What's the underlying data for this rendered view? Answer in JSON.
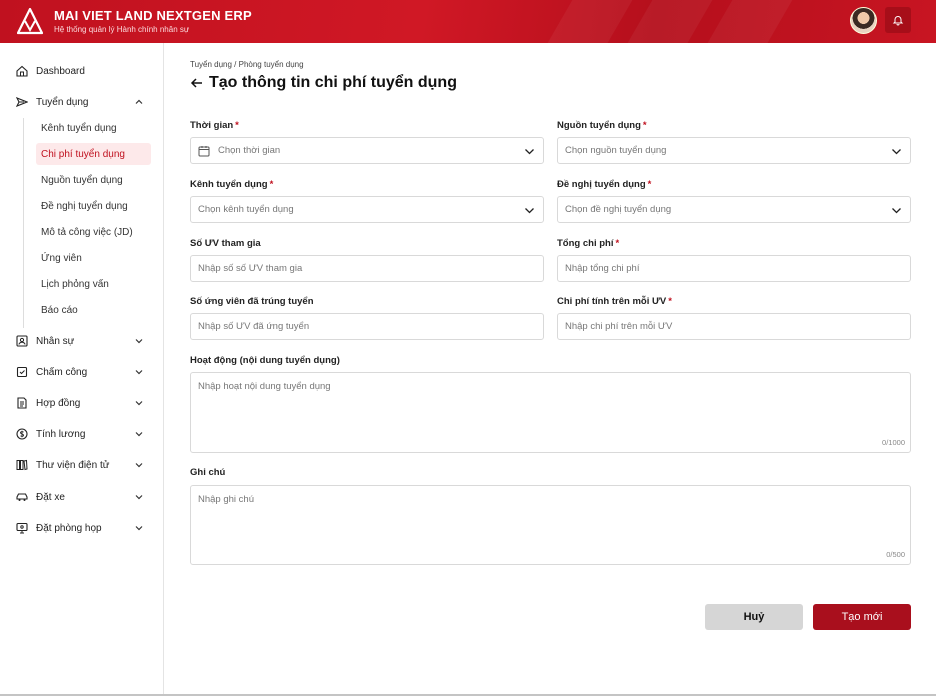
{
  "header": {
    "brand_title": "MAI VIET LAND NEXTGEN ERP",
    "brand_subtitle": "Hệ thống quản lý Hành chính nhân sự",
    "colors": {
      "primary": "#c0111f",
      "dark": "#a70e19"
    }
  },
  "sidebar": {
    "dashboard": "Dashboard",
    "recruitment": "Tuyển dụng",
    "sub_items": [
      "Kênh tuyển dụng",
      "Chi phí tuyển dụng",
      "Nguồn tuyển dụng",
      "Đề nghị tuyển dụng",
      "Mô tả công việc (JD)",
      "Ứng viên",
      "Lịch phỏng vấn",
      "Báo cáo"
    ],
    "groups": [
      "Nhân sự",
      "Chấm công",
      "Hợp đồng",
      "Tính lương",
      "Thư viện điện tử",
      "Đặt xe",
      "Đặt phòng họp"
    ]
  },
  "page": {
    "breadcrumb": "Tuyển dụng / Phòng tuyển dụng",
    "title": "Tạo thông tin chi phí tuyển dụng"
  },
  "form": {
    "time": {
      "label": "Thời gian",
      "placeholder": "Chọn thời gian"
    },
    "source": {
      "label": "Nguồn tuyển dụng",
      "placeholder": "Chọn nguồn tuyển dụng"
    },
    "channel": {
      "label": "Kênh tuyển dụng",
      "placeholder": "Chọn kênh tuyển dụng"
    },
    "proposal": {
      "label": "Đề nghị tuyển dụng",
      "placeholder": "Chọn đề nghị tuyển dụng"
    },
    "candidates": {
      "label": "Số ƯV tham gia",
      "placeholder": "Nhập số số ƯV tham gia"
    },
    "total_cost": {
      "label": "Tổng chi phí",
      "placeholder": "Nhập tổng chi phí"
    },
    "hired": {
      "label": "Số ứng viên đã trúng tuyển",
      "placeholder": "Nhập số ƯV đã ứng tuyển"
    },
    "cost_per": {
      "label": "Chi phí tính trên mỗi ƯV",
      "placeholder": "Nhập chi phí trên mỗi ƯV"
    },
    "activity": {
      "label": "Hoạt động (nội dung tuyển dụng)",
      "placeholder": "Nhập hoạt nội dung tuyển dụng",
      "counter": "0/1000"
    },
    "note": {
      "label": "Ghi chú",
      "placeholder": "Nhập ghi chú",
      "counter": "0/500"
    },
    "required_mark": "*"
  },
  "actions": {
    "cancel": "Huỷ",
    "create": "Tạo mới"
  }
}
